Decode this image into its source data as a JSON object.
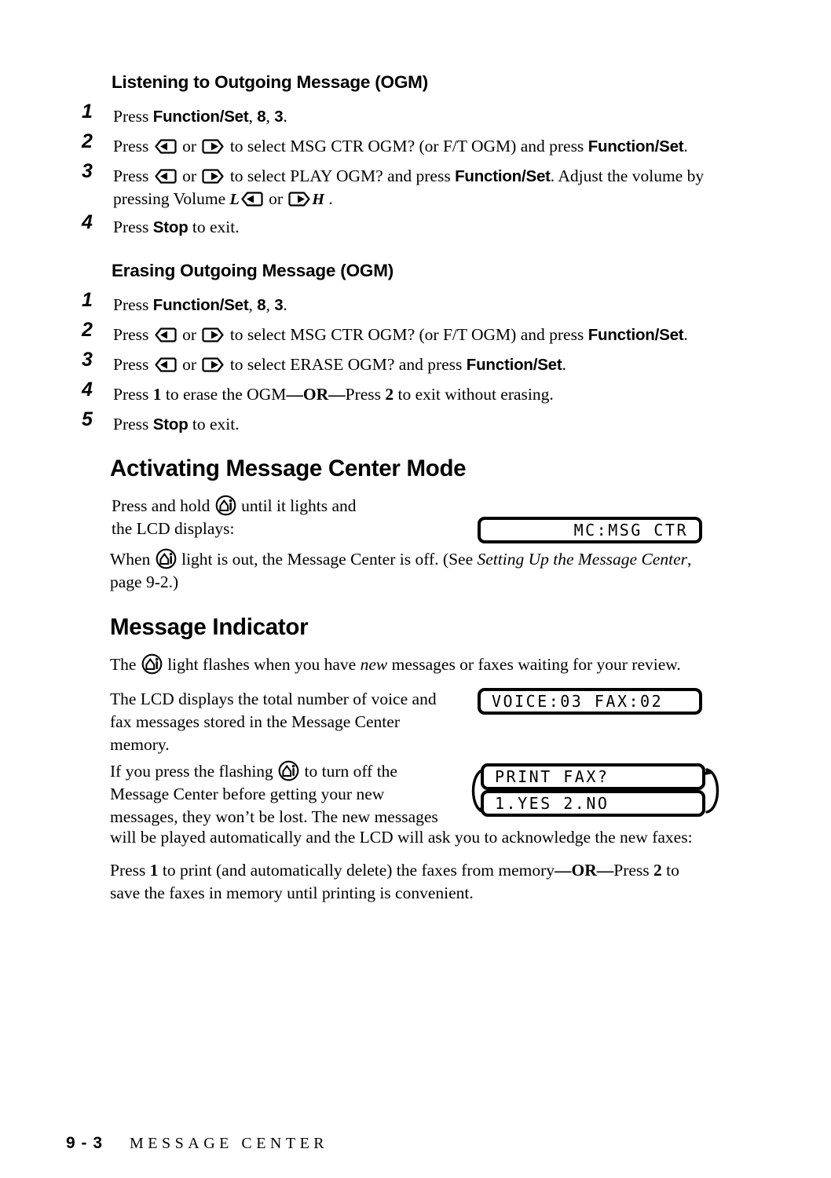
{
  "page": {
    "footer_page_number": "9 - 3",
    "footer_title": "MESSAGE CENTER"
  },
  "sections": [
    {
      "heading": "Listening to Outgoing Message (OGM)",
      "steps": [
        {
          "num": "1",
          "text_parts": [
            "Press ",
            "Function/Set",
            ", ",
            "8",
            ", ",
            "3",
            "."
          ]
        },
        {
          "num": "2",
          "text_parts": [
            "Press ",
            "left-arrow-key",
            " or ",
            "right-arrow-key",
            " to select MSG CTR OGM? (or F/T OGM) and press ",
            "Function/Set",
            "."
          ]
        },
        {
          "num": "3",
          "text_parts": [
            "Press ",
            "left-arrow-key",
            " or ",
            "right-arrow-key",
            " to select PLAY OGM? and press ",
            "Function/Set",
            ". Adjust the volume by pressing Volume ",
            "L",
            "left-arrow-key",
            " or ",
            "right-arrow-key",
            "H",
            "."
          ]
        },
        {
          "num": "4",
          "text_parts": [
            "Press ",
            "Stop",
            " to exit."
          ]
        }
      ]
    },
    {
      "heading": "Erasing Outgoing Message (OGM)",
      "steps": [
        {
          "num": "1",
          "text_parts": [
            "Press ",
            "Function/Set",
            ", ",
            "8",
            ", ",
            "3",
            "."
          ]
        },
        {
          "num": "2",
          "text_parts": [
            "Press ",
            "left-arrow-key",
            " or ",
            "right-arrow-key",
            " to select MSG CTR OGM? (or F/T OGM) and press ",
            "Function/Set",
            "."
          ]
        },
        {
          "num": "3",
          "text_parts": [
            "Press ",
            "left-arrow-key",
            " or ",
            "right-arrow-key",
            " to select ERASE OGM? and press ",
            "Function/Set",
            "."
          ]
        },
        {
          "num": "4",
          "text_parts": [
            "Press ",
            "1",
            " to erase the OGM",
            "—OR—",
            "Press ",
            "2",
            " to exit without erasing."
          ]
        },
        {
          "num": "5",
          "text_parts": [
            "Press ",
            "Stop",
            " to exit."
          ]
        }
      ]
    }
  ],
  "step_labels": {
    "s1_num": "1",
    "s2_num": "2",
    "s3_num": "3",
    "s4_num": "4",
    "s5_num": "5",
    "press": "Press ",
    "function_set": "Function/Set",
    "comma": ", ",
    "eight": "8",
    "three": "3",
    "period": ".",
    "or": " or ",
    "stop": "Stop",
    "to_exit": " to exit."
  },
  "listening": {
    "heading": "Listening to Outgoing Message (OGM)",
    "step1_pre": "Press ",
    "step1_key": "Function/Set",
    "step1_mid": ", ",
    "step1_n1": "8",
    "step1_mid2": ", ",
    "step1_n2": "3",
    "step1_end": ".",
    "step2_pre": "Press ",
    "step2_or": " or ",
    "step2_mid": " to select MSG CTR OGM? (or F/T OGM) and press ",
    "step2_key": "Function/Set",
    "step2_end": ".",
    "step3_pre": "Press ",
    "step3_or": " or ",
    "step3_mid": " to select PLAY OGM? and press ",
    "step3_key": "Function/Set",
    "step3_after": ". Adjust the volume by pressing Volume ",
    "step3_vol_l": "L",
    "step3_vol_or": " or ",
    "step3_vol_h": "H",
    "step3_end": " .",
    "step4_pre": "Press ",
    "step4_key": "Stop",
    "step4_end": " to exit."
  },
  "erasing": {
    "heading": "Erasing Outgoing Message (OGM)",
    "step1_pre": "Press ",
    "step1_key": "Function/Set",
    "step1_mid": ", ",
    "step1_n1": "8",
    "step1_mid2": ", ",
    "step1_n2": "3",
    "step1_end": ".",
    "step2_pre": "Press ",
    "step2_or": " or ",
    "step2_mid": " to select MSG CTR OGM? (or F/T OGM) and press ",
    "step2_key": "Function/Set",
    "step2_end": ".",
    "step3_pre": "Press ",
    "step3_or": " or ",
    "step3_mid": " to select ERASE OGM? and press ",
    "step3_key": "Function/Set",
    "step3_end": ".",
    "step4_pre": "Press ",
    "step4_n1": "1",
    "step4_mid": " to erase the OGM",
    "step4_or": "—OR—",
    "step4_mid2": "Press ",
    "step4_n2": "2",
    "step4_end": " to exit without erasing.",
    "step5_pre": "Press ",
    "step5_key": "Stop",
    "step5_end": " to exit."
  },
  "activating": {
    "heading": "Activating Message Center Mode",
    "p1_pre": "Press and hold ",
    "p1_post": " until it lights and",
    "p1_line2": "the LCD displays:",
    "p2_pre": "When ",
    "p2_mid": " light is out, the Message Center is off. (See ",
    "p2_italic": "Setting Up the Message Center",
    "p2_post": ",",
    "p2_line2": "page 9-2.)",
    "lcd_text": "MC:MSG CTR"
  },
  "message_indicator": {
    "heading": "Message Indicator",
    "p1_pre": "The ",
    "p1_mid": " light flashes when you have ",
    "p1_italic": "new",
    "p1_post": " messages or faxes waiting for your review.",
    "p2_line1": "The LCD displays the total number of voice and",
    "p2_line2": "fax messages stored in the Message Center",
    "p2_line3": "memory.",
    "lcd_counts": "VOICE:03 FAX:02",
    "p3_pre": "If you press the flashing ",
    "p3_post": " to turn off the",
    "p3_line2": "Message Center before getting your new",
    "p3_line3": "messages, they won’t be lost. The new messages",
    "p3_line4": "will be played automatically and the LCD will ask you to acknowledge the new faxes:",
    "lcd_prompt_1": "PRINT FAX?",
    "lcd_prompt_2": "1.YES 2.NO",
    "p4_pre": "Press ",
    "p4_n1": "1",
    "p4_mid": " to print (and automatically delete) the faxes from memory",
    "p4_or": "—OR—",
    "p4_mid2": "Press ",
    "p4_n2": "2",
    "p4_end": " to",
    "p4_line2": "save the faxes in memory until printing is convenient."
  },
  "icons": {
    "left_arrow_key": "left-arrow-key-icon",
    "right_arrow_key": "right-arrow-key-icon",
    "message_center_button": "message-center-button-icon",
    "cycle_arrows": "cycle-arrows-icon"
  },
  "colors": {
    "ink": "#000000",
    "paper": "#ffffff"
  }
}
